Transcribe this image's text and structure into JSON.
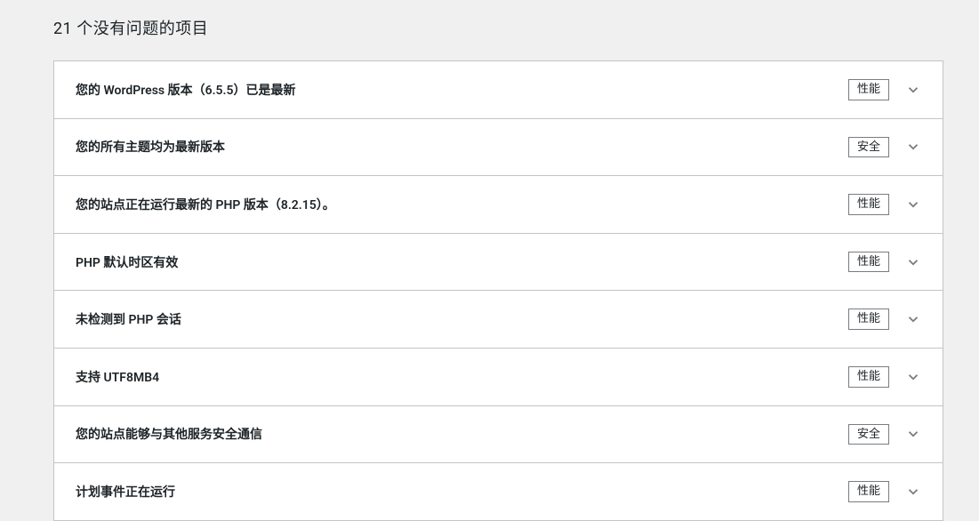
{
  "page_title": "21 个没有问题的项目",
  "badges": {
    "performance": "性能",
    "security": "安全"
  },
  "items": [
    {
      "label": "您的 WordPress 版本（6.5.5）已是最新",
      "badge": "performance"
    },
    {
      "label": "您的所有主题均为最新版本",
      "badge": "security"
    },
    {
      "label": "您的站点正在运行最新的 PHP 版本（8.2.15）。",
      "badge": "performance"
    },
    {
      "label": "PHP 默认时区有效",
      "badge": "performance"
    },
    {
      "label": "未检测到 PHP 会话",
      "badge": "performance"
    },
    {
      "label": "支持 UTF8MB4",
      "badge": "performance"
    },
    {
      "label": "您的站点能够与其他服务安全通信",
      "badge": "security"
    },
    {
      "label": "计划事件正在运行",
      "badge": "performance"
    }
  ]
}
